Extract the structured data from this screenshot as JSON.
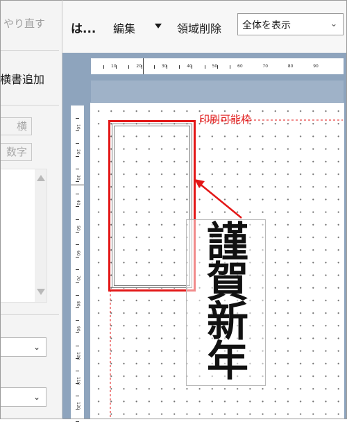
{
  "left_panel": {
    "undo_label": "やり直す",
    "add_horizontal_label": "横書追加",
    "button_yoko_label": "横",
    "button_number_label": "数字"
  },
  "toolbar": {
    "title": "は...",
    "edit_label": "編集",
    "delete_area_label": "領域削除",
    "view_select_value": "全体を表示"
  },
  "canvas": {
    "printable_area_label": "印刷可能枠",
    "vertical_text": [
      "謹",
      "賀",
      "新",
      "年"
    ]
  },
  "rulers": {
    "horizontal_labels": [
      "10",
      "20",
      "30",
      "40",
      "50",
      "60",
      "70",
      "80",
      "90"
    ],
    "vertical_labels": [
      "10",
      "20",
      "30",
      "40",
      "50",
      "60",
      "70",
      "80",
      "90",
      "100",
      "110",
      "120"
    ]
  },
  "colors": {
    "accent_red": "#e31717",
    "canvas_bg": "#8ea4bd",
    "text": "#1a1a1a"
  }
}
